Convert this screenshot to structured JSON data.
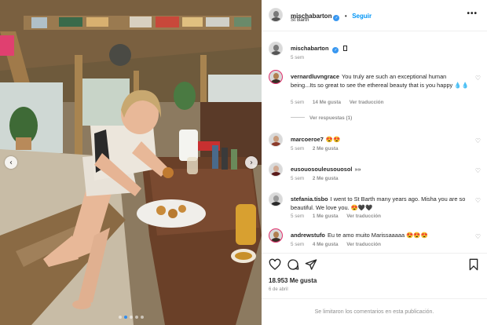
{
  "post": {
    "username": "mischabarton",
    "follow_label": "Seguir",
    "location": "St Barth",
    "more_label": "•••",
    "caption_time": "5 sem",
    "caption_emoji": "□"
  },
  "comments": [
    {
      "username": "vernardluvngrace",
      "text": "You truly are such an exceptional human being...Its so great to see the ethereal beauty that is you happy 💧💧",
      "time": "5 sem",
      "likes": "14 Me gusta",
      "reply": "Ver traducción",
      "view_replies": "Ver respuestas (1)"
    },
    {
      "username": "marcoeroe7",
      "text": "😍😍",
      "time": "5 sem",
      "likes": "2 Me gusta",
      "reply": ""
    },
    {
      "username": "eusouosouleusouosol",
      "text": "»»",
      "time": "5 sem",
      "likes": "2 Me gusta",
      "reply": ""
    },
    {
      "username": "stefania.tisbo",
      "text": "I went to St Barth many years ago. Misha you are so beautiful. We love you. 😍🖤🖤",
      "time": "5 sem",
      "likes": "1 Me gusta",
      "reply": "Ver traducción"
    },
    {
      "username": "andrewstufo",
      "text": "Eu te amo muito Marissaaaaa 😍😍😍",
      "time": "5 sem",
      "likes": "4 Me gusta",
      "reply": "Ver traducción"
    }
  ],
  "actions": {
    "likes": "18.953 Me gusta",
    "date": "6 de abril",
    "comments_limited": "Se limitaron los comentarios en esta publicación."
  },
  "carousel": {
    "prev": "‹",
    "next": "›"
  },
  "colors": {
    "accent": "#0095f6",
    "verified": "#3897f0",
    "muted": "#8e8e8e",
    "text": "#262626"
  }
}
